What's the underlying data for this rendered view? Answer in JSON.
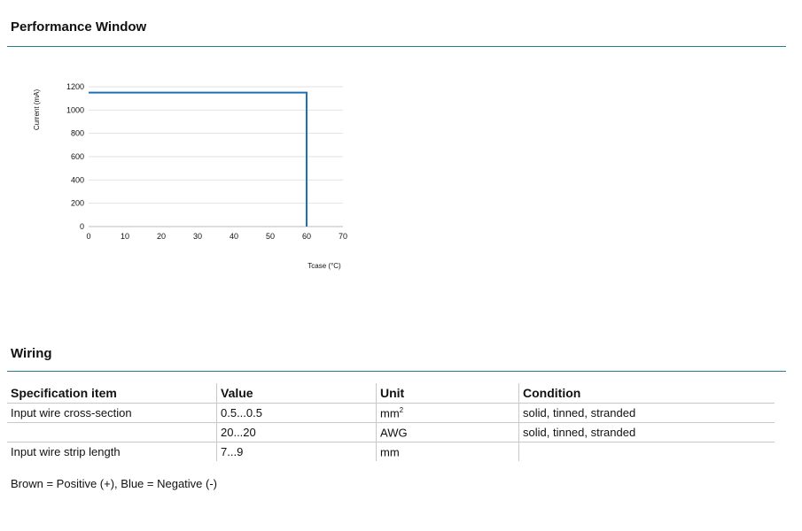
{
  "performance": {
    "title": "Performance Window"
  },
  "chart_data": {
    "type": "line",
    "xlabel": "Tcase (°C)",
    "ylabel": "Current (mA)",
    "xlim": [
      0,
      70
    ],
    "ylim": [
      0,
      1200
    ],
    "x_ticks": [
      0,
      10,
      20,
      30,
      40,
      50,
      60,
      70
    ],
    "y_ticks": [
      0,
      200,
      400,
      600,
      800,
      1000,
      1200
    ],
    "grid": "horizontal",
    "series": [
      {
        "points": [
          [
            0,
            1150
          ],
          [
            60,
            1150
          ],
          [
            60,
            0
          ]
        ],
        "color": "#1f6fb5"
      }
    ]
  },
  "wiring": {
    "title": "Wiring",
    "headers": [
      "Specification item",
      "Value",
      "Unit",
      "Condition"
    ],
    "rows": [
      {
        "item": "Input wire cross-section",
        "value": "0.5...0.5",
        "unit": "mm",
        "unit_sup": "2",
        "condition": "solid, tinned, stranded"
      },
      {
        "item": "",
        "value": "20...20",
        "unit": "AWG",
        "unit_sup": "",
        "condition": "solid, tinned, stranded"
      },
      {
        "item": "Input wire strip length",
        "value": "7...9",
        "unit": "mm",
        "unit_sup": "",
        "condition": ""
      }
    ],
    "note": "Brown = Positive (+), Blue = Negative (-)"
  }
}
